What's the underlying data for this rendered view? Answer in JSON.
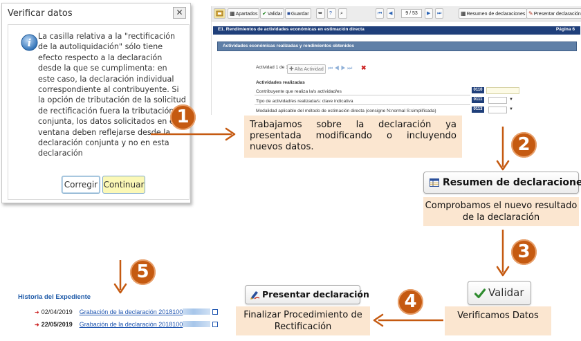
{
  "dialog": {
    "title": "Verificar datos",
    "close_label": "✕",
    "message": "La casilla relativa a la \"rectificación de la autoliquidación\" sólo tiene efecto respecto a la declaración desde la que se cumplimenta: en este caso, la declaración individual correspondiente al contribuyente. Si la opción de tributación de la solicitud de rectificación fuera la tributación conjunta, los datos solicitados en esta ventana deben reflejarse desde la declaración conjunta y no en esta declaración",
    "buttons": {
      "corregir": "Corregir",
      "continuar": "Continuar"
    }
  },
  "form": {
    "toolbar": {
      "apartados": "Apartados",
      "validar": "Validar",
      "guardar": "Guardar",
      "page_indicator": "9 / 53",
      "resumen": "Resumen de declaraciones",
      "presentar": "Presentar declaración"
    },
    "header_title": "E1.  Rendimientos de actividades económicas en estimación directa",
    "header_page": "Página 6",
    "section_title": "Actividades económicas realizadas y rendimientos obtenidos",
    "activity_counter": "Actividad 1 de 1",
    "alta_button": "Alta Actividad",
    "subsection": "Actividades realizadas",
    "rows": [
      {
        "label": "Contribuyente que realiza la/s actividad/es",
        "code": "0110"
      },
      {
        "label": "Tipo de actividad/es realizada/s: clave indicativa",
        "code": "0111"
      },
      {
        "label": "Modalidad aplicable del método de estimación directa (consigne N:normal S:simplificada)",
        "code": "0113"
      }
    ]
  },
  "steps": {
    "s1": {
      "number": "1",
      "text": "Trabajamos sobre la declaración ya presentada modificando o incluyendo nuevos datos."
    },
    "s2": {
      "number": "2",
      "button": "Resumen de declaraciones",
      "text": "Comprobamos el nuevo resultado de la declaración"
    },
    "s3": {
      "number": "3",
      "button": "Validar",
      "text": "Verificamos Datos"
    },
    "s4": {
      "number": "4",
      "button": "Presentar declaración",
      "text": "Finalizar Procedimiento de Rectificación"
    },
    "s5": {
      "number": "5"
    }
  },
  "history": {
    "title": "Historia del Expediente",
    "entries": [
      {
        "date": "02/04/2019",
        "link": "Grabación de la declaración 2018100"
      },
      {
        "date": "22/05/2019",
        "link": "Grabación de la declaración 2018100"
      }
    ]
  },
  "colors": {
    "accent": "#c55a11",
    "note_bg": "#fbe6d0",
    "form_header": "#1f3f7a",
    "link": "#1e55b0"
  }
}
